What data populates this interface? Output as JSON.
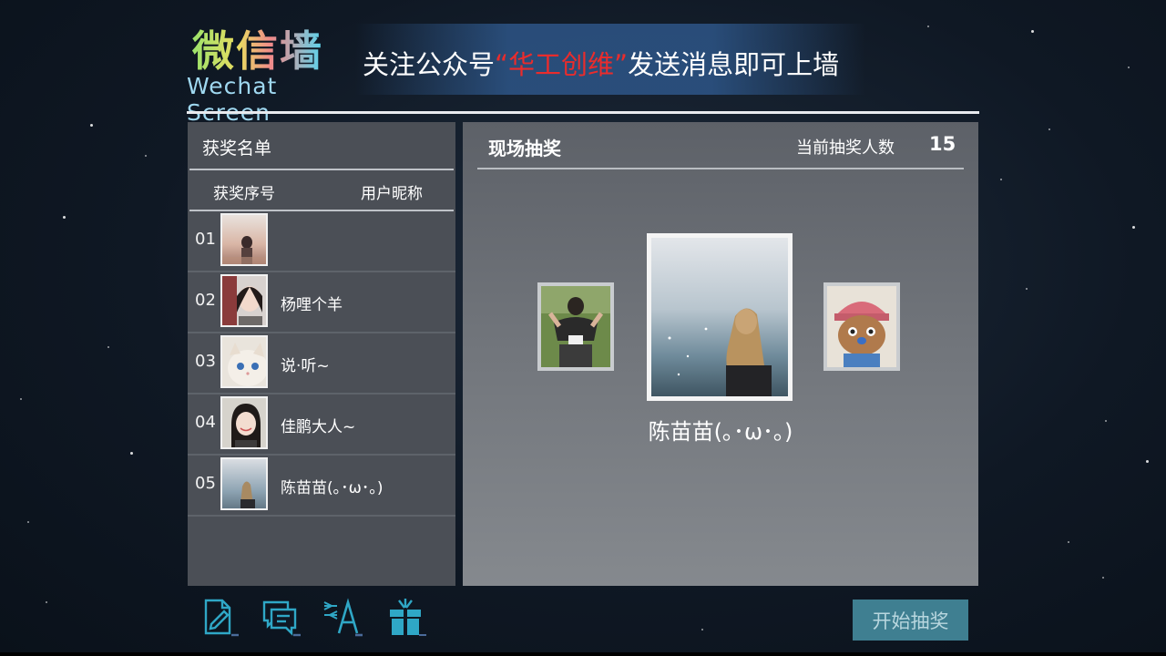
{
  "header": {
    "logo_cn": "微信墙",
    "logo_en": "Wechat Screen",
    "slogan_prefix": "关注公众号",
    "slogan_brand": "“华工创维”",
    "slogan_suffix": "发送消息即可上墙",
    "brand_color": "#ea2c2c"
  },
  "winners_panel": {
    "title": "获奖名单",
    "col_index": "获奖序号",
    "col_nickname": "用户昵称",
    "rows": [
      {
        "index": "01",
        "nickname": ""
      },
      {
        "index": "02",
        "nickname": "杨哩个羊"
      },
      {
        "index": "03",
        "nickname": "说·听~"
      },
      {
        "index": "04",
        "nickname": "佳鹏大人~"
      },
      {
        "index": "05",
        "nickname": "陈苗苗(｡･ω･｡)"
      }
    ]
  },
  "lottery_panel": {
    "title": "现场抽奖",
    "count_label": "当前抽奖人数",
    "count_value": "15",
    "winner_name": "陈苗苗(｡･ω･｡)"
  },
  "toolbar": {
    "icons": [
      "document-edit-icon",
      "message-icon",
      "text-sort-icon",
      "gift-icon"
    ],
    "start_button_label": "开始抽奖",
    "accent_color": "#3f7f91",
    "icon_color": "#2fa7c6"
  }
}
